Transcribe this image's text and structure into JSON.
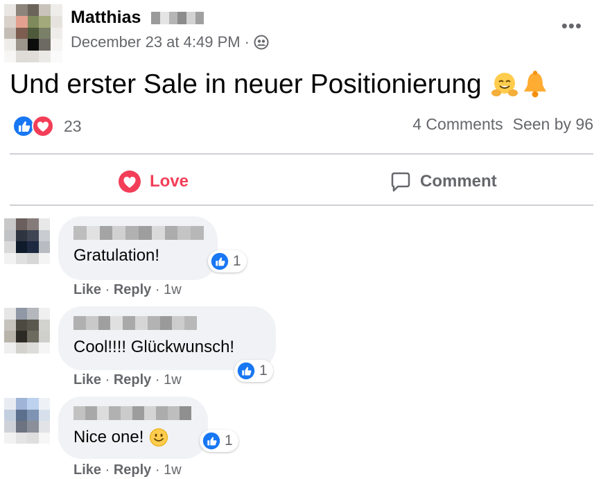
{
  "post": {
    "author_name": "Matthias",
    "timestamp": "December 23 at 4:49 PM",
    "separator": "·",
    "privacy_icon": "group-icon",
    "more_label": "•••",
    "text": "Und erster Sale in neuer Positionierung",
    "emojis": [
      "hugging-face-icon",
      "bell-icon"
    ]
  },
  "reactions": {
    "icons": [
      "like-icon",
      "love-icon"
    ],
    "count": "23",
    "comments": "4 Comments",
    "seen_by": "Seen by 96"
  },
  "actions": {
    "love_label": "Love",
    "comment_label": "Comment"
  },
  "comments": [
    {
      "text": "Gratulation!",
      "reaction_count": "1",
      "like": "Like",
      "reply": "Reply",
      "age": "1w",
      "dot": "·"
    },
    {
      "text": "Cool!!!! Glückwunsch!",
      "reaction_count": "1",
      "like": "Like",
      "reply": "Reply",
      "age": "1w",
      "dot": "·"
    },
    {
      "text": "Nice one!",
      "emoji": "smiling-face-icon",
      "reaction_count": "1",
      "like": "Like",
      "reply": "Reply",
      "age": "1w",
      "dot": "·"
    }
  ],
  "colors": {
    "like_blue": "#1877f2",
    "love_red": "#f33e58",
    "secondary_text": "#65676b",
    "bubble_bg": "#f0f2f5"
  }
}
